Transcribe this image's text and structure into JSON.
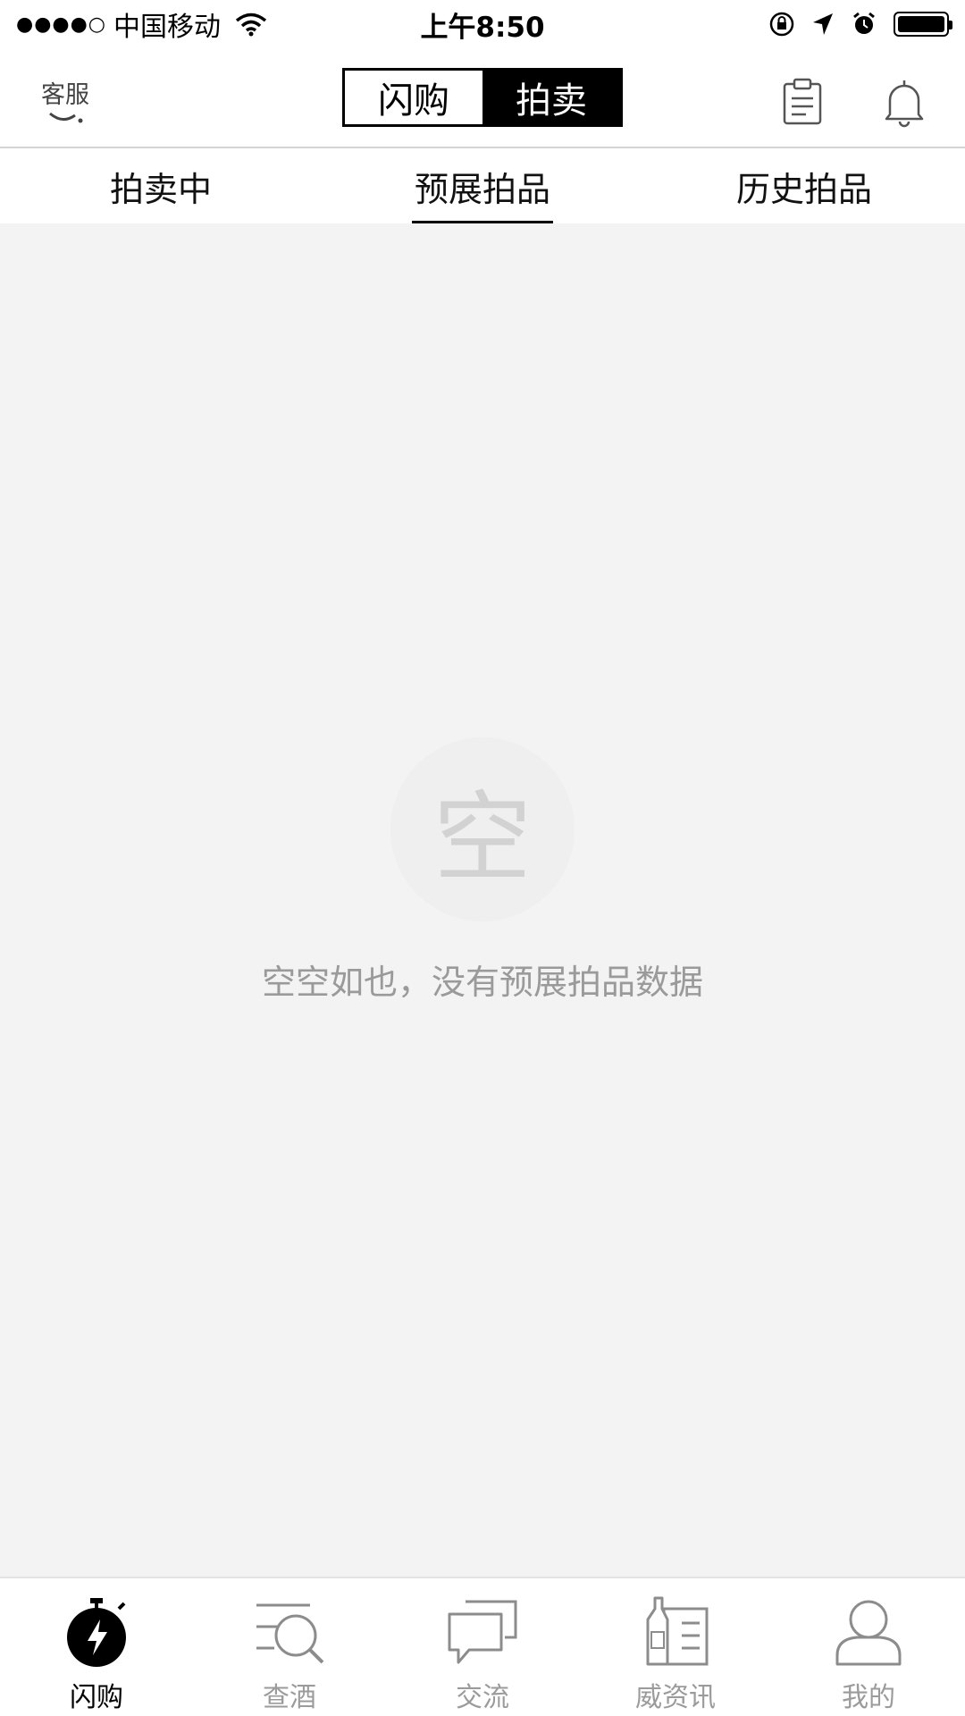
{
  "status_bar": {
    "signal": "●●●●○",
    "carrier": "中国移动",
    "time": "上午8:50"
  },
  "header": {
    "customer_service_label": "客服",
    "segments": [
      {
        "label": "闪购",
        "active": false
      },
      {
        "label": "拍卖",
        "active": true
      }
    ]
  },
  "tabs": [
    {
      "label": "拍卖中",
      "active": false
    },
    {
      "label": "预展拍品",
      "active": true
    },
    {
      "label": "历史拍品",
      "active": false
    }
  ],
  "empty_state": {
    "icon_char": "空",
    "message": "空空如也，没有预展拍品数据"
  },
  "tabbar": [
    {
      "label": "闪购",
      "icon": "stopwatch-bolt-icon",
      "active": true
    },
    {
      "label": "查酒",
      "icon": "search-list-icon",
      "active": false
    },
    {
      "label": "交流",
      "icon": "chat-bubbles-icon",
      "active": false
    },
    {
      "label": "威资讯",
      "icon": "bottle-news-icon",
      "active": false
    },
    {
      "label": "我的",
      "icon": "user-icon",
      "active": false
    }
  ]
}
